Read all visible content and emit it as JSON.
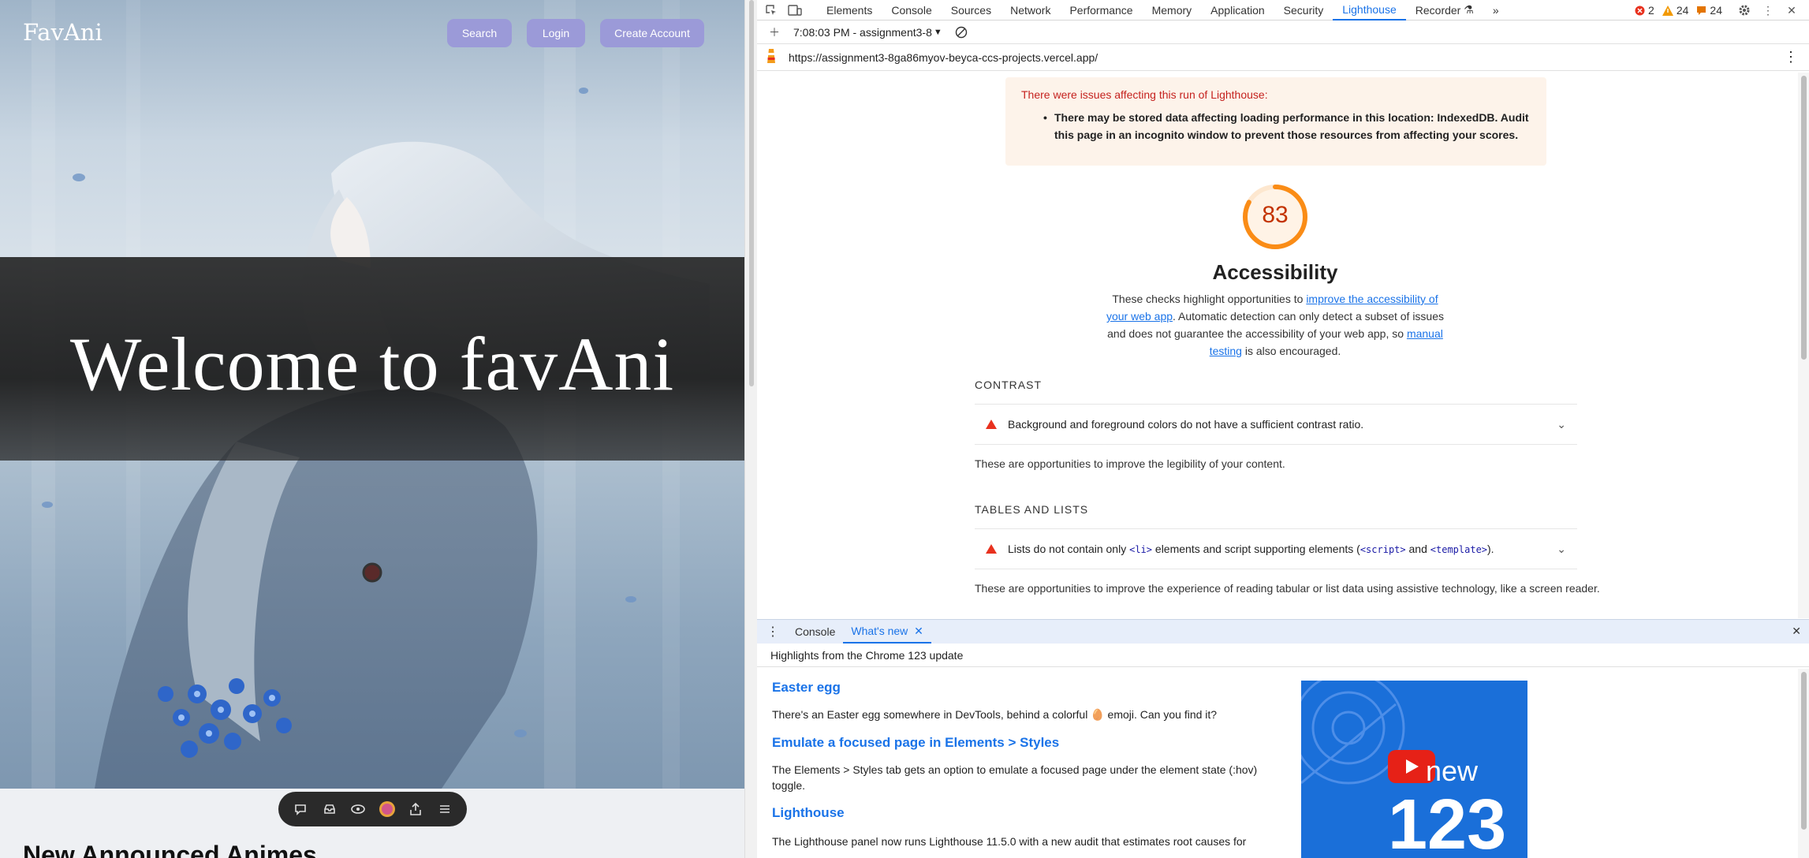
{
  "site": {
    "logo": "FavAni",
    "nav": {
      "search": "Search",
      "login": "Login",
      "create_account": "Create Account"
    },
    "hero_title": "Welcome to favAni",
    "section_title": "New Announced Animes",
    "accent_color": "#9b9ad8"
  },
  "floating_toolbar": {
    "icons": [
      "comment-icon",
      "inbox-icon",
      "eye-icon",
      "avatar",
      "share-icon",
      "menu-icon"
    ]
  },
  "devtools": {
    "tabs": [
      "Elements",
      "Console",
      "Sources",
      "Network",
      "Performance",
      "Memory",
      "Application",
      "Security",
      "Lighthouse",
      "Recorder"
    ],
    "active_tab": "Lighthouse",
    "status": {
      "errors": "2",
      "warnings": "24",
      "issues": "24"
    },
    "report_selector": "7:08:03 PM - assignment3-8",
    "url": "https://assignment3-8ga86myov-beyca-ccs-projects.vercel.app/"
  },
  "report": {
    "warning_title": "There were issues affecting this run of Lighthouse:",
    "warning_item": "There may be stored data affecting loading performance in this location: IndexedDB. Audit this page in an incognito window to prevent those resources from affecting your scores.",
    "score": "83",
    "score_fraction": 0.83,
    "score_color": "#fa8c16",
    "category": "Accessibility",
    "desc_1": "These checks highlight opportunities to ",
    "desc_link_1": "improve the accessibility of your web app",
    "desc_2": ". Automatic detection can only detect a subset of issues and does not guarantee the accessibility of your web app, so ",
    "desc_link_2": "manual testing",
    "desc_3": " is also encouraged.",
    "groups": [
      {
        "title": "CONTRAST",
        "audit": "Background and foreground colors do not have a sufficient contrast ratio.",
        "desc": "These are opportunities to improve the legibility of your content."
      },
      {
        "title": "TABLES AND LISTS",
        "audit_pre": "Lists do not contain only ",
        "audit_code_1": "<li>",
        "audit_mid": " elements and script supporting elements (",
        "audit_code_2": "<script>",
        "audit_and": " and ",
        "audit_code_3": "<template>",
        "audit_post": ").",
        "desc": "These are opportunities to improve the experience of reading tabular or list data using assistive technology, like a screen reader."
      }
    ]
  },
  "drawer": {
    "tabs": [
      "Console",
      "What's new"
    ],
    "active_tab": "What's new",
    "header": "Highlights from the Chrome 123 update",
    "items": [
      {
        "title": "Easter egg",
        "body": "There's an Easter egg somewhere in DevTools, behind a colorful 🥚 emoji. Can you find it?"
      },
      {
        "title": "Emulate a focused page in Elements > Styles",
        "body": "The Elements > Styles tab gets an option to emulate a focused page under the element state (:hov) toggle."
      },
      {
        "title": "Lighthouse",
        "body": "The Lighthouse panel now runs Lighthouse 11.5.0 with a new audit that estimates root causes for"
      }
    ],
    "video": {
      "label": "new",
      "version": "123"
    }
  }
}
